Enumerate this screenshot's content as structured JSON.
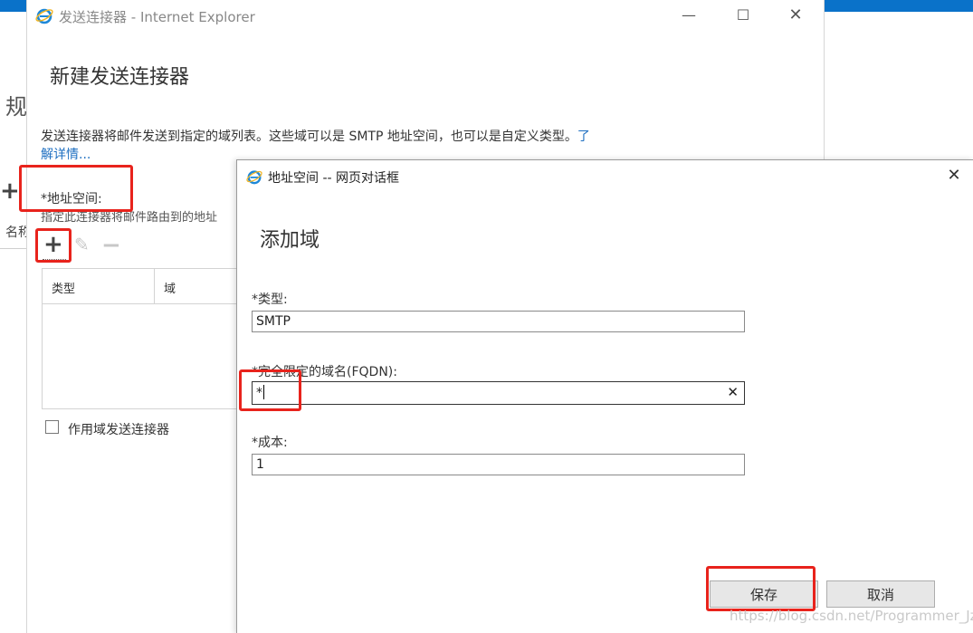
{
  "background": {
    "page_title_char": "规",
    "plus_glyph": "+",
    "name_column": "名称"
  },
  "ie_window": {
    "title": "发送连接器 - Internet Explorer",
    "minimize": "—",
    "maximize": "☐",
    "close": "✕",
    "heading": "新建发送连接器",
    "description": "发送连接器将邮件发送到指定的域列表。这些域可以是 SMTP 地址空间，也可以是自定义类型。",
    "learn_more": "了解详情...",
    "address_space_label": "*地址空间:",
    "address_space_hint": "指定此连接器将邮件路由到的地址",
    "toolbar": {
      "add": "+",
      "edit": "✎",
      "remove": "−"
    },
    "table": {
      "col_type": "类型",
      "col_domain": "域"
    },
    "scoped_connector_label": "作用域发送连接器",
    "scoped_connector_checked": false
  },
  "dialog": {
    "title": "地址空间 -- 网页对话框",
    "close": "✕",
    "heading": "添加域",
    "type_label": "*类型:",
    "type_value": "SMTP",
    "fqdn_label": "*完全限定的域名(FQDN):",
    "fqdn_value": "*",
    "clear_icon": "✕",
    "cost_label": "*成本:",
    "cost_value": "1",
    "save_label": "保存",
    "cancel_label": "取消"
  },
  "watermark": "https://blog.csdn.net/Programmer_Jz",
  "colors": {
    "accent": "#0a72c9",
    "link": "#1e6fc1",
    "annotation": "#e8231c"
  }
}
